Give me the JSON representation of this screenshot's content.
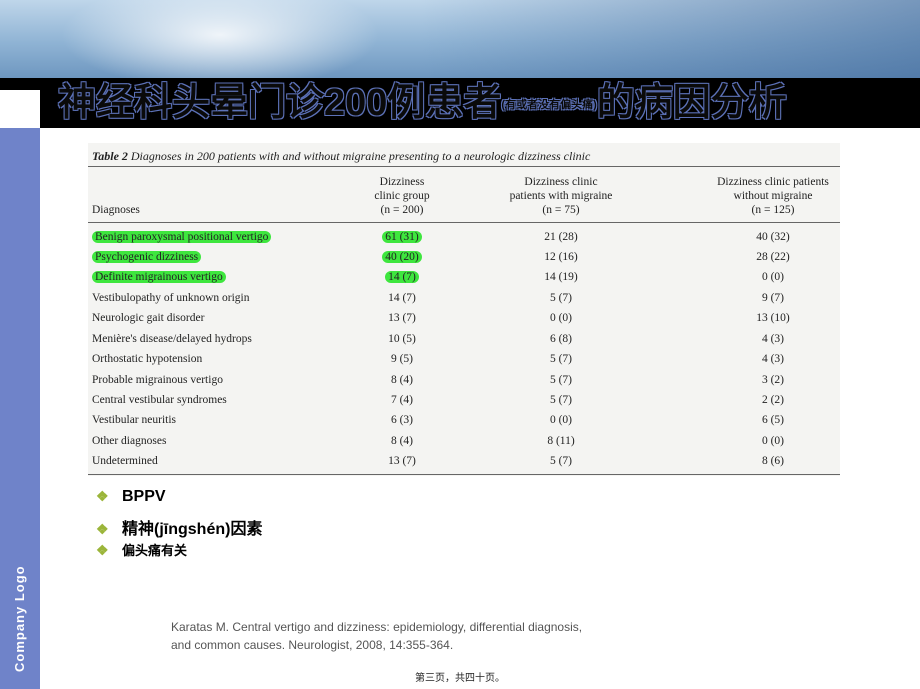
{
  "title": {
    "main_a": "神经科头晕门诊200例患者",
    "small": "(有或者没有偏头痛)",
    "main_b": "的病因分析"
  },
  "sidebar": {
    "logo_text": "Company Logo"
  },
  "table": {
    "caption_label": "Table 2",
    "caption_text": "Diagnoses in 200 patients with and without migraine presenting to a neurologic dizziness clinic",
    "columns": [
      {
        "lines": [
          "Diagnoses"
        ]
      },
      {
        "lines": [
          "Dizziness",
          "clinic group",
          "(n = 200)"
        ]
      },
      {
        "lines": [
          "Dizziness clinic",
          "patients with migraine",
          "(n = 75)"
        ]
      },
      {
        "lines": [
          "Dizziness clinic patients",
          "without migraine",
          "(n = 125)"
        ]
      }
    ],
    "rows": [
      {
        "diagnosis": "Benign paroxysmal positional vertigo",
        "all": "61 (31)",
        "with": "21 (28)",
        "without": "40 (32)"
      },
      {
        "diagnosis": "Psychogenic dizziness",
        "all": "40 (20)",
        "with": "12 (16)",
        "without": "28 (22)"
      },
      {
        "diagnosis": "Definite migrainous vertigo",
        "all": "14 (7)",
        "with": "14 (19)",
        "without": "0 (0)"
      },
      {
        "diagnosis": "Vestibulopathy of unknown origin",
        "all": "14 (7)",
        "with": "5 (7)",
        "without": "9 (7)"
      },
      {
        "diagnosis": "Neurologic gait disorder",
        "all": "13 (7)",
        "with": "0 (0)",
        "without": "13 (10)"
      },
      {
        "diagnosis": "Menière's disease/delayed hydrops",
        "all": "10 (5)",
        "with": "6 (8)",
        "without": "4 (3)"
      },
      {
        "diagnosis": "Orthostatic hypotension",
        "all": "9 (5)",
        "with": "5 (7)",
        "without": "4 (3)"
      },
      {
        "diagnosis": "Probable migrainous vertigo",
        "all": "8 (4)",
        "with": "5 (7)",
        "without": "3 (2)"
      },
      {
        "diagnosis": "Central vestibular syndromes",
        "all": "7 (4)",
        "with": "5 (7)",
        "without": "2 (2)"
      },
      {
        "diagnosis": "Vestibular neuritis",
        "all": "6 (3)",
        "with": "0 (0)",
        "without": "6 (5)"
      },
      {
        "diagnosis": "Other diagnoses",
        "all": "8 (4)",
        "with": "8 (11)",
        "without": "0 (0)"
      },
      {
        "diagnosis": "Undetermined",
        "all": "13 (7)",
        "with": "5 (7)",
        "without": "8 (6)"
      }
    ],
    "highlight_color": "#3ee63e"
  },
  "bullets": [
    {
      "icon": "diamond-bullet-icon",
      "text": "BPPV"
    },
    {
      "icon": "diamond-bullet-icon",
      "text": "精神(jīngshén)因素"
    },
    {
      "icon": "diamond-bullet-icon",
      "text": "偏头痛有关"
    }
  ],
  "reference": {
    "line1": "Karatas M. Central vertigo and dizziness: epidemiology, differential diagnosis,",
    "line2": "and common causes. Neurologist, 2008, 14:355-364."
  },
  "footer": "第三页，共四十页。"
}
